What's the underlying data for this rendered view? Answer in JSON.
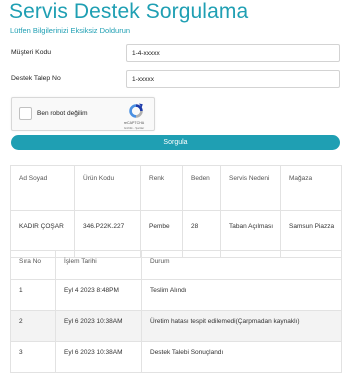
{
  "page": {
    "title": "Servis Destek Sorgulama",
    "subtitle": "Lütfen Bilgilerinizi Eksiksiz Doldurun"
  },
  "form": {
    "customer_code_label": "Müşteri Kodu",
    "customer_code_value": "1-4-xxxxx",
    "request_no_label": "Destek Talep No",
    "request_no_value": "1-xxxxx",
    "submit_label": "Sorgula"
  },
  "captcha": {
    "label": "Ben robot değilim",
    "brand": "reCAPTCHA",
    "links": "Gizlilik - Şartlar",
    "checked": false,
    "logo_icon": "recaptcha-logo-icon"
  },
  "product_table": {
    "headers": [
      "Ad Soyad",
      "Ürün Kodu",
      "Renk",
      "Beden",
      "Servis Nedeni",
      "Mağaza"
    ],
    "row": {
      "name": "KADIR ÇOŞAR",
      "product_code": "346.P22K.227",
      "color": "Pembe",
      "size": "28",
      "reason": "Taban Açılması",
      "store": "Samsun Piazza"
    }
  },
  "status_table": {
    "headers": [
      "Sıra No",
      "İşlem Tarihi",
      "Durum"
    ],
    "rows": [
      {
        "no": "1",
        "date": "Eyl 4 2023 8:48PM",
        "status": "Teslim Alındı"
      },
      {
        "no": "2",
        "date": "Eyl 6 2023 10:38AM",
        "status": "Üretim hatası tespit edilemedi(Çarpmadan kaynaklı)"
      },
      {
        "no": "3",
        "date": "Eyl 6 2023 10:38AM",
        "status": "Destek Talebi Sonuçlandı"
      }
    ]
  },
  "colors": {
    "accent": "#1f9fb3",
    "border": "#e2e2e2",
    "striped_row": "#f3f3f3"
  }
}
